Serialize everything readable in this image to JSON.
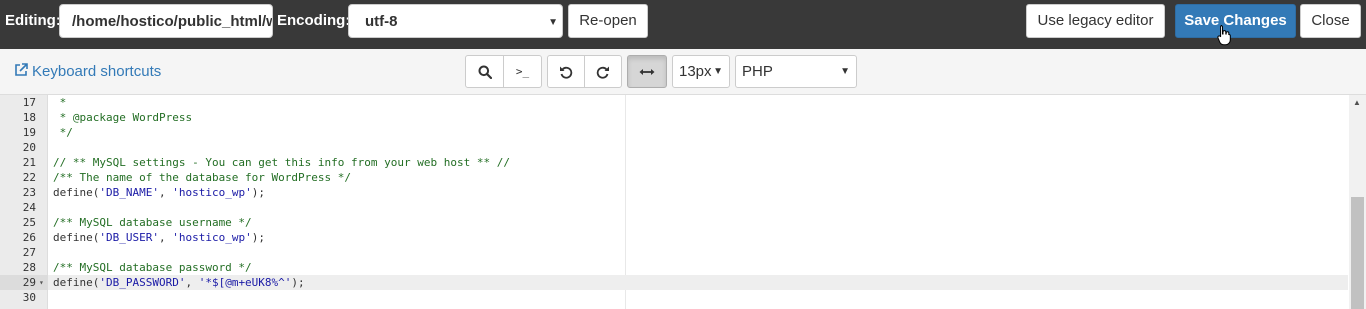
{
  "header": {
    "editing_label": "Editing:",
    "file_path": "/home/hostico/public_html/wp-config.php",
    "encoding_label": "Encoding:",
    "encoding_value": "utf-8",
    "reopen_label": "Re-open",
    "legacy_label": "Use legacy editor",
    "save_label": "Save Changes",
    "close_label": "Close"
  },
  "toolbar": {
    "keyboard_shortcuts": "Keyboard shortcuts",
    "font_size": "13px",
    "mode": "PHP",
    "icons": [
      "search-icon",
      "terminal-icon",
      "undo-icon",
      "redo-icon",
      "wrap-icon"
    ]
  },
  "editor": {
    "active_line": 29,
    "lines": [
      {
        "n": "17",
        "text": " *"
      },
      {
        "n": "18",
        "text": " * @package WordPress"
      },
      {
        "n": "19",
        "text": " */"
      },
      {
        "n": "20",
        "text": ""
      },
      {
        "n": "21",
        "text": "// ** MySQL settings - You can get this info from your web host ** //"
      },
      {
        "n": "22",
        "text": "/** The name of the database for WordPress */"
      },
      {
        "n": "23",
        "fn": "define(",
        "s1": "'DB_NAME'",
        "mid": ", ",
        "s2": "'hostico_wp'",
        "end": ");"
      },
      {
        "n": "24",
        "text": ""
      },
      {
        "n": "25",
        "text": "/** MySQL database username */"
      },
      {
        "n": "26",
        "fn": "define(",
        "s1": "'DB_USER'",
        "mid": ", ",
        "s2": "'hostico_wp'",
        "end": ");"
      },
      {
        "n": "27",
        "text": ""
      },
      {
        "n": "28",
        "text": "/** MySQL database password */"
      },
      {
        "n": "29",
        "fn": "define(",
        "s1": "'DB_PASSWORD'",
        "mid": ", ",
        "s2": "'*$[@m+eUK8%^'",
        "end": ");"
      },
      {
        "n": "30",
        "text": ""
      }
    ]
  },
  "colors": {
    "header_bg": "#393939",
    "primary": "#337ab7",
    "comment": "#236e24",
    "string": "#1a1aa6"
  }
}
